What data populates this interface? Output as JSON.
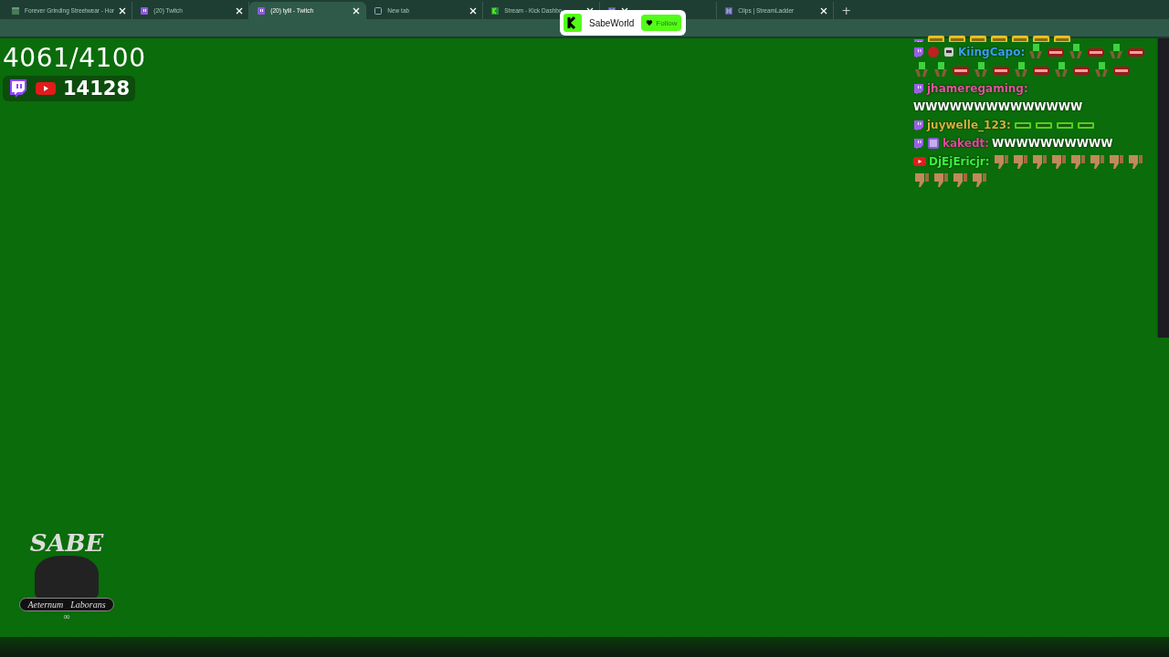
{
  "browser": {
    "tabs": [
      {
        "label": "Forever Grinding Streetwear - Hor",
        "kind": "store",
        "selected": false
      },
      {
        "label": "(20) Twitch",
        "kind": "twitch",
        "selected": false
      },
      {
        "label": "(20) tylil - Twitch",
        "kind": "twitch",
        "selected": true
      },
      {
        "label": "New tab",
        "kind": "page",
        "selected": false
      },
      {
        "label": "Stream - Kick Dashbo",
        "kind": "kick",
        "selected": false
      },
      {
        "kind": "ladder",
        "selected": false
      },
      {
        "label": "Clips | StreamLadder",
        "kind": "ladder",
        "selected": false
      }
    ],
    "new_tab_button": "+"
  },
  "follow_popup": {
    "channel": "SabeWorld",
    "button": "Follow"
  },
  "counter": {
    "goal": "4061/4100",
    "viewers": "14128"
  },
  "chat": [
    {
      "kind": "twitch",
      "emotes": [
        {
          "kind": "did"
        },
        {
          "kind": "did"
        },
        {
          "kind": "did"
        },
        {
          "kind": "did"
        },
        {
          "kind": "did"
        },
        {
          "kind": "did"
        },
        {
          "kind": "did"
        }
      ]
    },
    {
      "kind": "twitch",
      "badges": [
        {
          "kind": "gem"
        },
        {
          "kind": "bot"
        }
      ],
      "name": "KiingCapo:",
      "color": "#3aa0e8",
      "emotes": [
        {
          "kind": "w"
        },
        {
          "kind": "ttg"
        },
        {
          "kind": "w"
        },
        {
          "kind": "ttg"
        },
        {
          "kind": "w"
        },
        {
          "kind": "ttg"
        },
        {
          "kind": "w"
        },
        {
          "kind": "w"
        },
        {
          "kind": "ttg"
        },
        {
          "kind": "w"
        },
        {
          "kind": "ttg"
        },
        {
          "kind": "w"
        },
        {
          "kind": "ttg"
        },
        {
          "kind": "w"
        },
        {
          "kind": "ttg"
        },
        {
          "kind": "w"
        },
        {
          "kind": "ttg"
        }
      ]
    },
    {
      "kind": "twitch",
      "name": "jhameregaming:",
      "color": "#e0559a",
      "text": "WWWWWWWWWWWWWW"
    },
    {
      "kind": "twitch",
      "name": "juywelle_123:",
      "color": "#d2b43c",
      "emotes": [
        {
          "kind": "tag"
        },
        {
          "kind": "tag"
        },
        {
          "kind": "tag"
        },
        {
          "kind": "tag"
        }
      ]
    },
    {
      "kind": "twitch",
      "badges": [
        {
          "kind": "sub"
        }
      ],
      "name": "kakedt:",
      "color": "#e04a9a",
      "text": "WWWWWWWWWW"
    },
    {
      "kind": "youtube",
      "name": "DjEjEricjr:",
      "color": "#3cf03c",
      "emotes": [
        {
          "kind": "thumbs"
        },
        {
          "kind": "thumbs"
        },
        {
          "kind": "thumbs"
        },
        {
          "kind": "thumbs"
        },
        {
          "kind": "thumbs"
        },
        {
          "kind": "thumbs"
        },
        {
          "kind": "thumbs"
        },
        {
          "kind": "thumbs"
        },
        {
          "kind": "thumbs"
        },
        {
          "kind": "thumbs"
        },
        {
          "kind": "thumbs"
        },
        {
          "kind": "thumbs"
        }
      ]
    }
  ],
  "logo": {
    "title": "SABE",
    "banner_left": "Aeternum",
    "banner_right": "Laborans",
    "symbol": "∞"
  }
}
